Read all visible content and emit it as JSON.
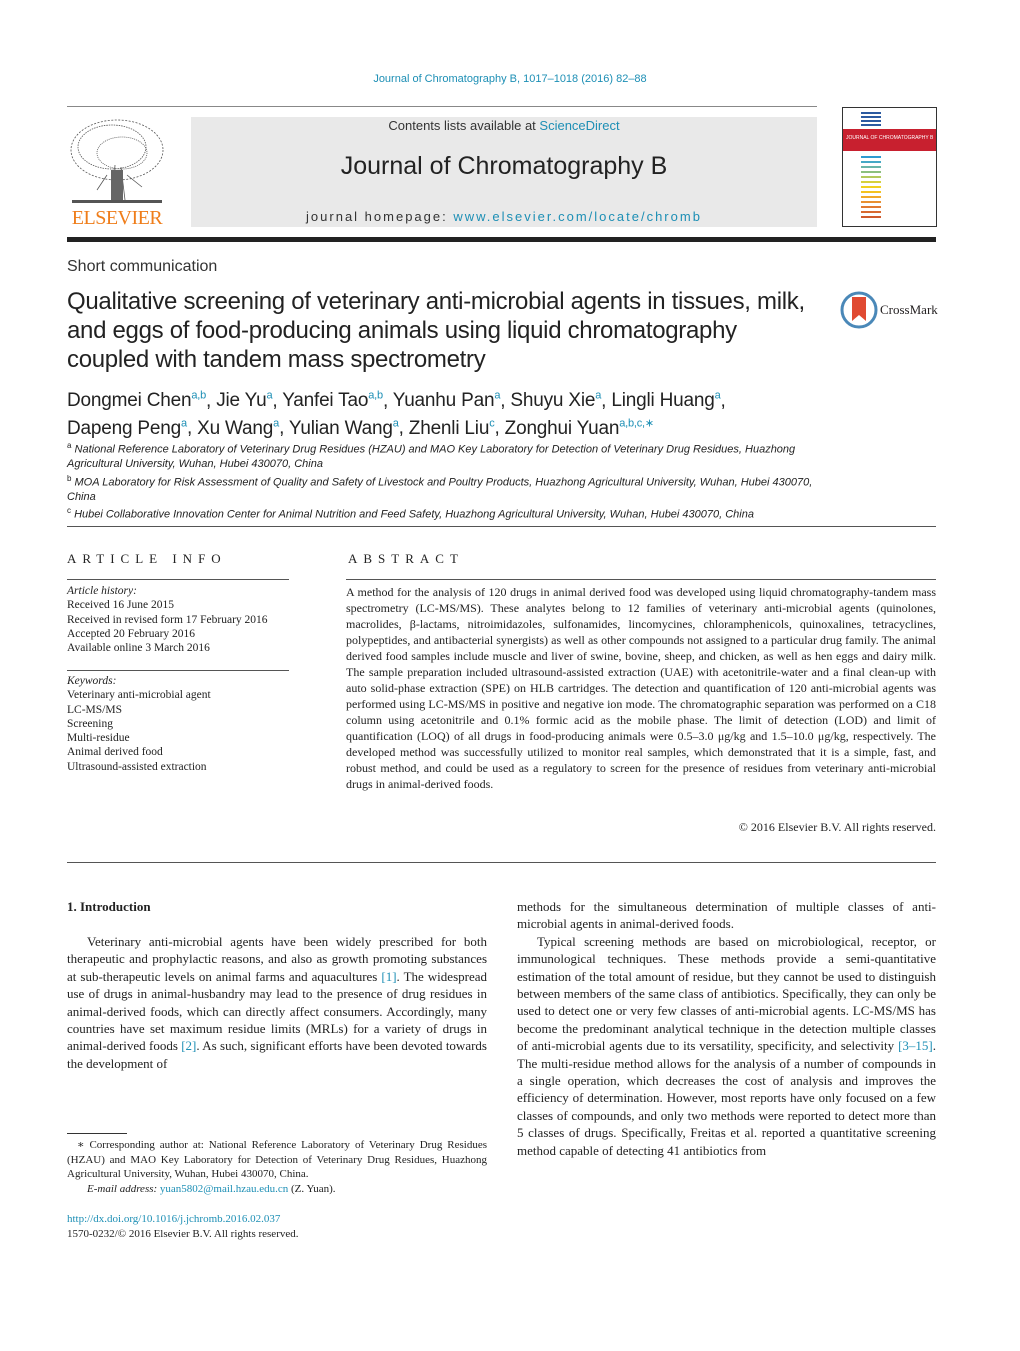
{
  "header": {
    "citation": "Journal of Chromatography B, 1017–1018 (2016) 82–88",
    "contents_prefix": "Contents lists available at ",
    "contents_link": "ScienceDirect",
    "journal_title": "Journal of Chromatography B",
    "homepage_prefix": "journal homepage: ",
    "homepage_link": "www.elsevier.com/locate/chromb",
    "publisher_logo": "ELSEVIER",
    "cover_title": "JOURNAL OF CHROMATOGRAPHY B"
  },
  "article": {
    "type": "Short communication",
    "title": "Qualitative screening of veterinary anti-microbial agents in tissues, milk, and eggs of food-producing animals using liquid chromatography coupled with tandem mass spectrometry",
    "crossmark_label": "CrossMark",
    "authors": [
      {
        "name": "Dongmei Chen",
        "aff": "a,b"
      },
      {
        "name": "Jie Yu",
        "aff": "a"
      },
      {
        "name": "Yanfei Tao",
        "aff": "a,b"
      },
      {
        "name": "Yuanhu Pan",
        "aff": "a"
      },
      {
        "name": "Shuyu Xie",
        "aff": "a"
      },
      {
        "name": "Lingli Huang",
        "aff": "a"
      },
      {
        "name": "Dapeng Peng",
        "aff": "a"
      },
      {
        "name": "Xu Wang",
        "aff": "a"
      },
      {
        "name": "Yulian Wang",
        "aff": "a"
      },
      {
        "name": "Zhenli Liu",
        "aff": "c"
      },
      {
        "name": "Zonghui Yuan",
        "aff": "a,b,c,∗"
      }
    ],
    "affiliations": [
      {
        "key": "a",
        "text": "National Reference Laboratory of Veterinary Drug Residues (HZAU) and MAO Key Laboratory for Detection of Veterinary Drug Residues, Huazhong Agricultural University, Wuhan, Hubei 430070, China"
      },
      {
        "key": "b",
        "text": "MOA Laboratory for Risk Assessment of Quality and Safety of Livestock and Poultry Products, Huazhong Agricultural University, Wuhan, Hubei 430070, China"
      },
      {
        "key": "c",
        "text": "Hubei Collaborative Innovation Center for Animal Nutrition and Feed Safety, Huazhong Agricultural University, Wuhan, Hubei 430070, China"
      }
    ]
  },
  "article_info": {
    "heading": "ARTICLE INFO",
    "history_label": "Article history:",
    "history": [
      "Received 16 June 2015",
      "Received in revised form 17 February 2016",
      "Accepted 20 February 2016",
      "Available online 3 March 2016"
    ],
    "keywords_label": "Keywords:",
    "keywords": [
      "Veterinary anti-microbial agent",
      "LC-MS/MS",
      "Screening",
      "Multi-residue",
      "Animal derived food",
      "Ultrasound-assisted extraction"
    ]
  },
  "abstract": {
    "heading": "ABSTRACT",
    "text": "A method for the analysis of 120 drugs in animal derived food was developed using liquid chromatography-tandem mass spectrometry (LC-MS/MS). These analytes belong to 12 families of veterinary anti-microbial agents (quinolones, macrolides, β-lactams, nitroimidazoles, sulfonamides, lincomycines, chloramphenicols, quinoxalines, tetracyclines, polypeptides, and antibacterial synergists) as well as other compounds not assigned to a particular drug family. The animal derived food samples include muscle and liver of swine, bovine, sheep, and chicken, as well as hen eggs and dairy milk. The sample preparation included ultrasound-assisted extraction (UAE) with acetonitrile-water and a final clean-up with auto solid-phase extraction (SPE) on HLB cartridges. The detection and quantification of 120 anti-microbial agents was performed using LC-MS/MS in positive and negative ion mode. The chromatographic separation was performed on a C18 column using acetonitrile and 0.1% formic acid as the mobile phase. The limit of detection (LOD) and limit of quantification (LOQ) of all drugs in food-producing animals were 0.5–3.0 μg/kg and 1.5–10.0 μg/kg, respectively. The developed method was successfully utilized to monitor real samples, which demonstrated that it is a simple, fast, and robust method, and could be used as a regulatory to screen for the presence of residues from veterinary anti-microbial drugs in animal-derived foods.",
    "copyright": "© 2016 Elsevier B.V. All rights reserved."
  },
  "intro": {
    "heading": "1.  Introduction",
    "p1_a": "Veterinary anti-microbial agents have been widely prescribed for both therapeutic and prophylactic reasons, and also as growth promoting substances at sub-therapeutic levels on animal farms and aquacultures ",
    "ref1": "[1]",
    "p1_b": ". The widespread use of drugs in animal-husbandry may lead to the presence of drug residues in animal-derived foods, which can directly affect consumers. Accordingly, many countries have set maximum residue limits (MRLs) for a variety of drugs in animal-derived foods ",
    "ref2": "[2]",
    "p1_c": ". As such, significant efforts have been devoted towards the development of",
    "p1_cont": "methods for the simultaneous determination of multiple classes of anti-microbial agents in animal-derived foods.",
    "p2_a": "Typical screening methods are based on microbiological, receptor, or immunological techniques. These methods provide a semi-quantitative estimation of the total amount of residue, but they cannot be used to distinguish between members of the same class of antibiotics. Specifically, they can only be used to detect one or very few classes of anti-microbial agents. LC-MS/MS has become the predominant analytical technique in the detection multiple classes of anti-microbial agents due to its versatility, specificity, and selectivity ",
    "ref3": "[3–15]",
    "p2_b": ". The multi-residue method allows for the analysis of a number of compounds in a single operation, which decreases the cost of analysis and improves the efficiency of determination. However, most reports have only focused on a few classes of compounds, and only two methods were reported to detect more than 5 classes of drugs. Specifically, Freitas et al. reported a quantitative screening method capable of detecting 41 antibiotics from"
  },
  "footnote": {
    "corresponding": "∗  Corresponding author at: National Reference Laboratory of Veterinary Drug Residues (HZAU) and MAO Key Laboratory for Detection of Veterinary Drug Residues, Huazhong Agricultural University, Wuhan, Hubei 430070, China.",
    "email_label": "E-mail address: ",
    "email": "yuan5802@mail.hzau.edu.cn",
    "email_suffix": " (Z. Yuan).",
    "doi": "http://dx.doi.org/10.1016/j.jchromb.2016.02.037",
    "issn": "1570-0232/© 2016 Elsevier B.V. All rights reserved."
  },
  "colors": {
    "link": "#1d8fb5",
    "elsevier_orange": "#ef7d1a",
    "masthead_bg": "#e9e9e9"
  }
}
